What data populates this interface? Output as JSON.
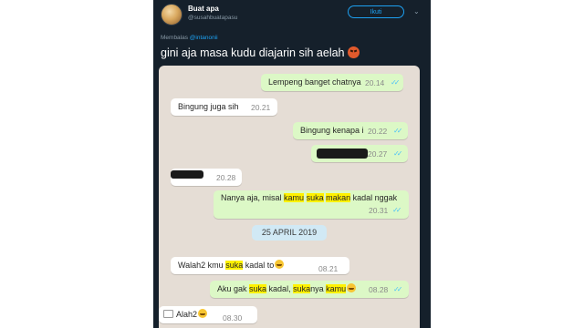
{
  "tweet": {
    "display_name": "Buat apa",
    "handle": "@susahbuatapasu",
    "follow_label": "Ikuti",
    "reply_prefix": "Membalas",
    "reply_to": "@intanonii",
    "text": "gini aja masa kudu diajarin sih aelah",
    "icons": {
      "avatar": "profile-photo",
      "caret": "chevron-down-icon",
      "emoji": "angry-face-emoji"
    },
    "colors": {
      "background": "#15202b",
      "accent": "#1da1f2"
    }
  },
  "chat": {
    "colors": {
      "background": "#e5ddd5",
      "outgoing": "#dcf8c6",
      "incoming": "#ffffff",
      "highlight": "#fff200",
      "ticks": "#4fc3f7"
    },
    "date_separator": "25 APRIL 2019",
    "messages": [
      {
        "side": "out",
        "text": "Lempeng banget chatnya",
        "time": "20.14",
        "ticks": "✓✓"
      },
      {
        "side": "in",
        "text": "Bingung juga sih",
        "time": "20.21"
      },
      {
        "side": "out",
        "text": "Bingung kenapa i",
        "time": "20.22",
        "ticks": "✓✓"
      },
      {
        "side": "out",
        "text": "",
        "time": "20.27",
        "ticks": "✓✓",
        "redacted": true
      },
      {
        "side": "in",
        "text": "",
        "time": "20.28",
        "redacted": true
      },
      {
        "side": "out",
        "parts": [
          "Nanya aja, misal ",
          "kamu",
          " ",
          "suka",
          " ",
          "makan",
          " kadal nggak"
        ],
        "time": "20.31",
        "ticks": "✓✓"
      },
      {
        "side": "in",
        "parts": [
          "Walah2 kmu ",
          "suka",
          " kadal to"
        ],
        "time": "08.21",
        "emoji": "grinning-face-emoji"
      },
      {
        "side": "out",
        "parts": [
          "Aku gak ",
          "suka",
          " kadal, ",
          "suka",
          "nya ",
          "kamu"
        ],
        "time": "08.28",
        "ticks": "✓✓",
        "emoji": "blowing-kiss-emoji"
      },
      {
        "side": "in",
        "text": "Alah2",
        "time": "08.30",
        "emoji": "grinning-face-emoji",
        "has_thumbnail": true
      }
    ]
  }
}
